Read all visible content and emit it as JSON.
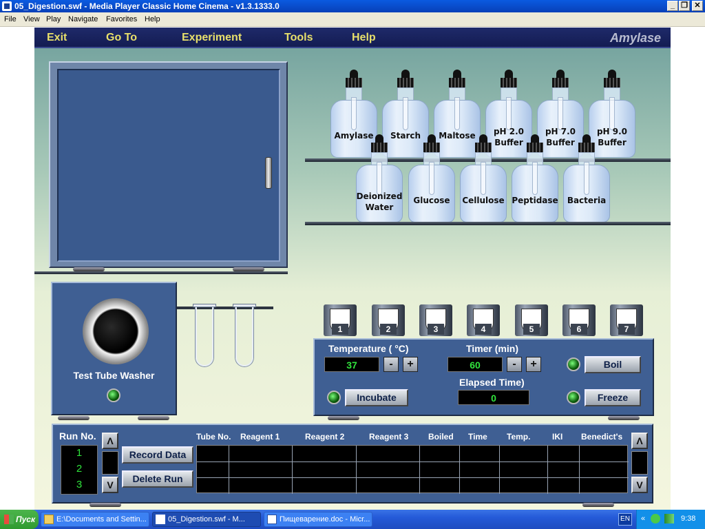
{
  "window": {
    "title": "05_Digestion.swf - Media Player Classic Home Cinema - v1.3.1333.0"
  },
  "menubar": [
    "File",
    "View",
    "Play",
    "Navigate",
    "Favorites",
    "Help"
  ],
  "app": {
    "nav": [
      "Exit",
      "Go To",
      "Experiment",
      "Tools",
      "Help"
    ],
    "title": "Amylase"
  },
  "bottles_top": [
    {
      "label": "Amylase"
    },
    {
      "label": "Starch"
    },
    {
      "label": "Maltose"
    },
    {
      "label": "pH 2.0 Buffer"
    },
    {
      "label": "pH 7.0 Buffer"
    },
    {
      "label": "pH 9.0 Buffer"
    }
  ],
  "bottles_bottom": [
    {
      "label": "Deionized Water"
    },
    {
      "label": "Glucose"
    },
    {
      "label": "Cellulose"
    },
    {
      "label": "Peptidase"
    },
    {
      "label": "Bacteria"
    }
  ],
  "washer": {
    "label": "Test Tube Washer"
  },
  "slots": [
    "1",
    "2",
    "3",
    "4",
    "5",
    "6",
    "7"
  ],
  "control": {
    "temperature_label": "Temperature ( °C)",
    "temperature_value": "37",
    "timer_label": "Timer (min)",
    "timer_value": "60",
    "elapsed_label": "Elapsed Time)",
    "elapsed_value": "0",
    "minus": "-",
    "plus": "+",
    "boil": "Boil",
    "incubate": "Incubate",
    "freeze": "Freeze"
  },
  "data_table": {
    "run_label": "Run No.",
    "runs": [
      "1",
      "2",
      "3"
    ],
    "record_button": "Record Data",
    "delete_button": "Delete Run",
    "up": "Λ",
    "down": "V",
    "headers": [
      "Tube No.",
      "Reagent 1",
      "Reagent 2",
      "Reagent 3",
      "Boiled",
      "Time",
      "Temp.",
      "IKI",
      "Benedict's"
    ]
  },
  "taskbar": {
    "start": "Пуск",
    "tasks": [
      {
        "label": "E:\\Documents and Settin...",
        "icon": "folder-icon"
      },
      {
        "label": "05_Digestion.swf - M...",
        "icon": "media-player-icon"
      },
      {
        "label": "Пищеварение.doc - Micr...",
        "icon": "word-icon"
      }
    ],
    "lang": "EN",
    "time": "9:38"
  }
}
